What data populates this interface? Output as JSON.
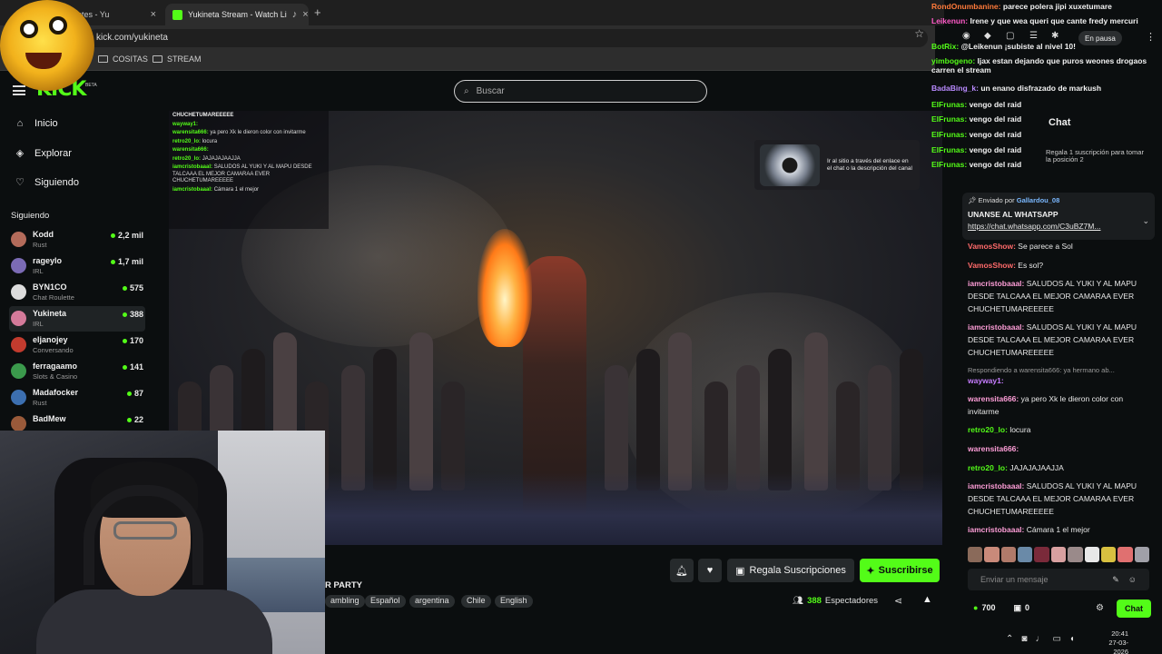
{
  "browser": {
    "tabs": [
      {
        "label": "o presidentes - Yu"
      },
      {
        "label": "Yukineta Stream - Watch Li"
      }
    ],
    "url": "kick.com/yukineta",
    "bookmarks": [
      "COSITAS",
      "STREAM"
    ]
  },
  "header": {
    "logo": "KICK",
    "beta": "BETA",
    "search_placeholder": "Buscar"
  },
  "nav": {
    "items": [
      {
        "label": "Inicio",
        "icon": "home-icon"
      },
      {
        "label": "Explorar",
        "icon": "compass-icon"
      },
      {
        "label": "Siguiendo",
        "icon": "heart-icon"
      }
    ]
  },
  "following": {
    "title": "Siguiendo",
    "items": [
      {
        "name": "Kodd",
        "category": "Rust",
        "viewers": "2,2 mil",
        "avatar_color": "#b36b5a"
      },
      {
        "name": "rageylo",
        "category": "IRL",
        "viewers": "1,7 mil",
        "avatar_color": "#7b6bb5"
      },
      {
        "name": "BYN1CO",
        "category": "Chat Roulette",
        "viewers": "575",
        "avatar_color": "#dcdcdc"
      },
      {
        "name": "Yukineta",
        "category": "IRL",
        "viewers": "388",
        "avatar_color": "#d47a9a"
      },
      {
        "name": "eljanojey",
        "category": "Conversando",
        "viewers": "170",
        "avatar_color": "#c23b2e"
      },
      {
        "name": "ferragaamo",
        "category": "Slots & Casino",
        "viewers": "141",
        "avatar_color": "#3b9a4c"
      },
      {
        "name": "Madafocker",
        "category": "Rust",
        "viewers": "87",
        "avatar_color": "#3c6fb0"
      },
      {
        "name": "BadMew",
        "category": "",
        "viewers": "22",
        "avatar_color": "#9a5a3a"
      }
    ]
  },
  "video_overlay_chat": [
    {
      "user": "",
      "text": "CHUCHETUMAREEEEE"
    },
    {
      "user": "wayway1:",
      "text": ""
    },
    {
      "user": "warensita666:",
      "text": "ya pero Xk le dieron color con invitarme"
    },
    {
      "user": "retro20_lo:",
      "text": "locura"
    },
    {
      "user": "warensita666:",
      "text": ""
    },
    {
      "user": "retro20_lo:",
      "text": "JAJAJAJAAJJA"
    },
    {
      "user": "iamcristobaaal:",
      "text": "SALUDOS AL YUKI Y AL MAPU DESDE TALCAAA EL MEJOR CAMARAA EVER CHUCHETUMAREEEEE"
    },
    {
      "user": "iamcristobaaal:",
      "text": "Cámara 1 el mejor"
    }
  ],
  "video_ad": {
    "text": "Ir al sitio a través del enlace en el chat o la descripción del canal"
  },
  "stream": {
    "title": "R PARTY",
    "tags": [
      "ambling",
      "Español",
      "argentina",
      "Chile",
      "English"
    ],
    "gift_label": "Regala Suscripciones",
    "subscribe_label": "Suscribirse",
    "viewers": "388",
    "viewers_label": "Espectadores"
  },
  "floating_chat": [
    {
      "user": "RondOnumbanine:",
      "text": "parece polera jipi xuxetumare",
      "color": "#ff7a3a"
    },
    {
      "user": "Leikenun:",
      "text": "Irene y que wea queri que cante fredy mercuri",
      "color": "#ff5ac8"
    },
    {
      "user": "BotRix:",
      "text": "@Leikenun ¡subiste al nivel 10!",
      "color": "#53fc18"
    },
    {
      "user": "yimbogeno:",
      "text": "Ijax estan dejando que puros weones drogaos carren el stream",
      "color": "#53fc18"
    },
    {
      "user": "BadaBing_k:",
      "text": "un enano disfrazado de markush",
      "color": "#b98aff"
    },
    {
      "user": "ElFrunas:",
      "text": "vengo del raid",
      "color": "#53fc18"
    },
    {
      "user": "ElFrunas:",
      "text": "vengo del raid",
      "color": "#53fc18"
    },
    {
      "user": "ElFrunas:",
      "text": "vengo del raid",
      "color": "#53fc18"
    },
    {
      "user": "ElFrunas:",
      "text": "vengo del raid",
      "color": "#53fc18"
    },
    {
      "user": "ElFrunas:",
      "text": "vengo del raid",
      "color": "#53fc18"
    }
  ],
  "browser_status": {
    "paused": "En pausa"
  },
  "chat": {
    "title": "Chat",
    "gift_banner": "Regala 1 suscripción para tomar la posición 2",
    "pinned": {
      "by_label": "Enviado por",
      "by_user": "Gallardou_08",
      "title": "UNANSE AL WHATSAPP",
      "link": "https://chat.whatsapp.com/C3uBZ7M..."
    },
    "messages": [
      {
        "user": "VamosShow:",
        "text": "Se parece a Sol",
        "color": "#ff6a6a"
      },
      {
        "user": "VamosShow:",
        "text": "Es sol?",
        "color": "#ff6a6a"
      },
      {
        "user": "iamcristobaaal:",
        "text": "SALUDOS AL YUKI Y AL MAPU DESDE TALCAAA EL MEJOR CAMARAA EVER CHUCHETUMAREEEEE",
        "color": "#ff9ed8"
      },
      {
        "user": "iamcristobaaal:",
        "text": "SALUDOS AL YUKI Y AL MAPU DESDE TALCAAA EL MEJOR CAMARAA EVER CHUCHETUMAREEEEE",
        "color": "#ff9ed8"
      },
      {
        "user": "wayway1:",
        "text": "",
        "color": "#c77dff"
      },
      {
        "user": "warensita666:",
        "text": "ya pero Xk le dieron color con invitarme",
        "color": "#ff9ed8"
      },
      {
        "user": "retro20_lo:",
        "text": "locura",
        "color": "#53fc18"
      },
      {
        "user": "warensita666:",
        "text": "",
        "color": "#ff9ed8"
      },
      {
        "user": "retro20_lo:",
        "text": "JAJAJAJAAJJA",
        "color": "#53fc18"
      },
      {
        "user": "iamcristobaaal:",
        "text": "SALUDOS AL YUKI Y AL MAPU DESDE TALCAAA EL MEJOR CAMARAA EVER CHUCHETUMAREEEEE",
        "color": "#ff9ed8"
      },
      {
        "user": "iamcristobaaal:",
        "text": "Cámara 1 el mejor",
        "color": "#ff9ed8"
      }
    ],
    "reply_hint": "Respondiendo a warensita666: ya hermano ab...",
    "input_placeholder": "Enviar un mensaje",
    "points": "700",
    "gifts": "0",
    "send_label": "Chat"
  },
  "taskbar": {
    "time": "20:41",
    "date": "27-03-2026"
  },
  "colors": {
    "accent": "#53fc18",
    "bg": "#0b0e0f"
  }
}
